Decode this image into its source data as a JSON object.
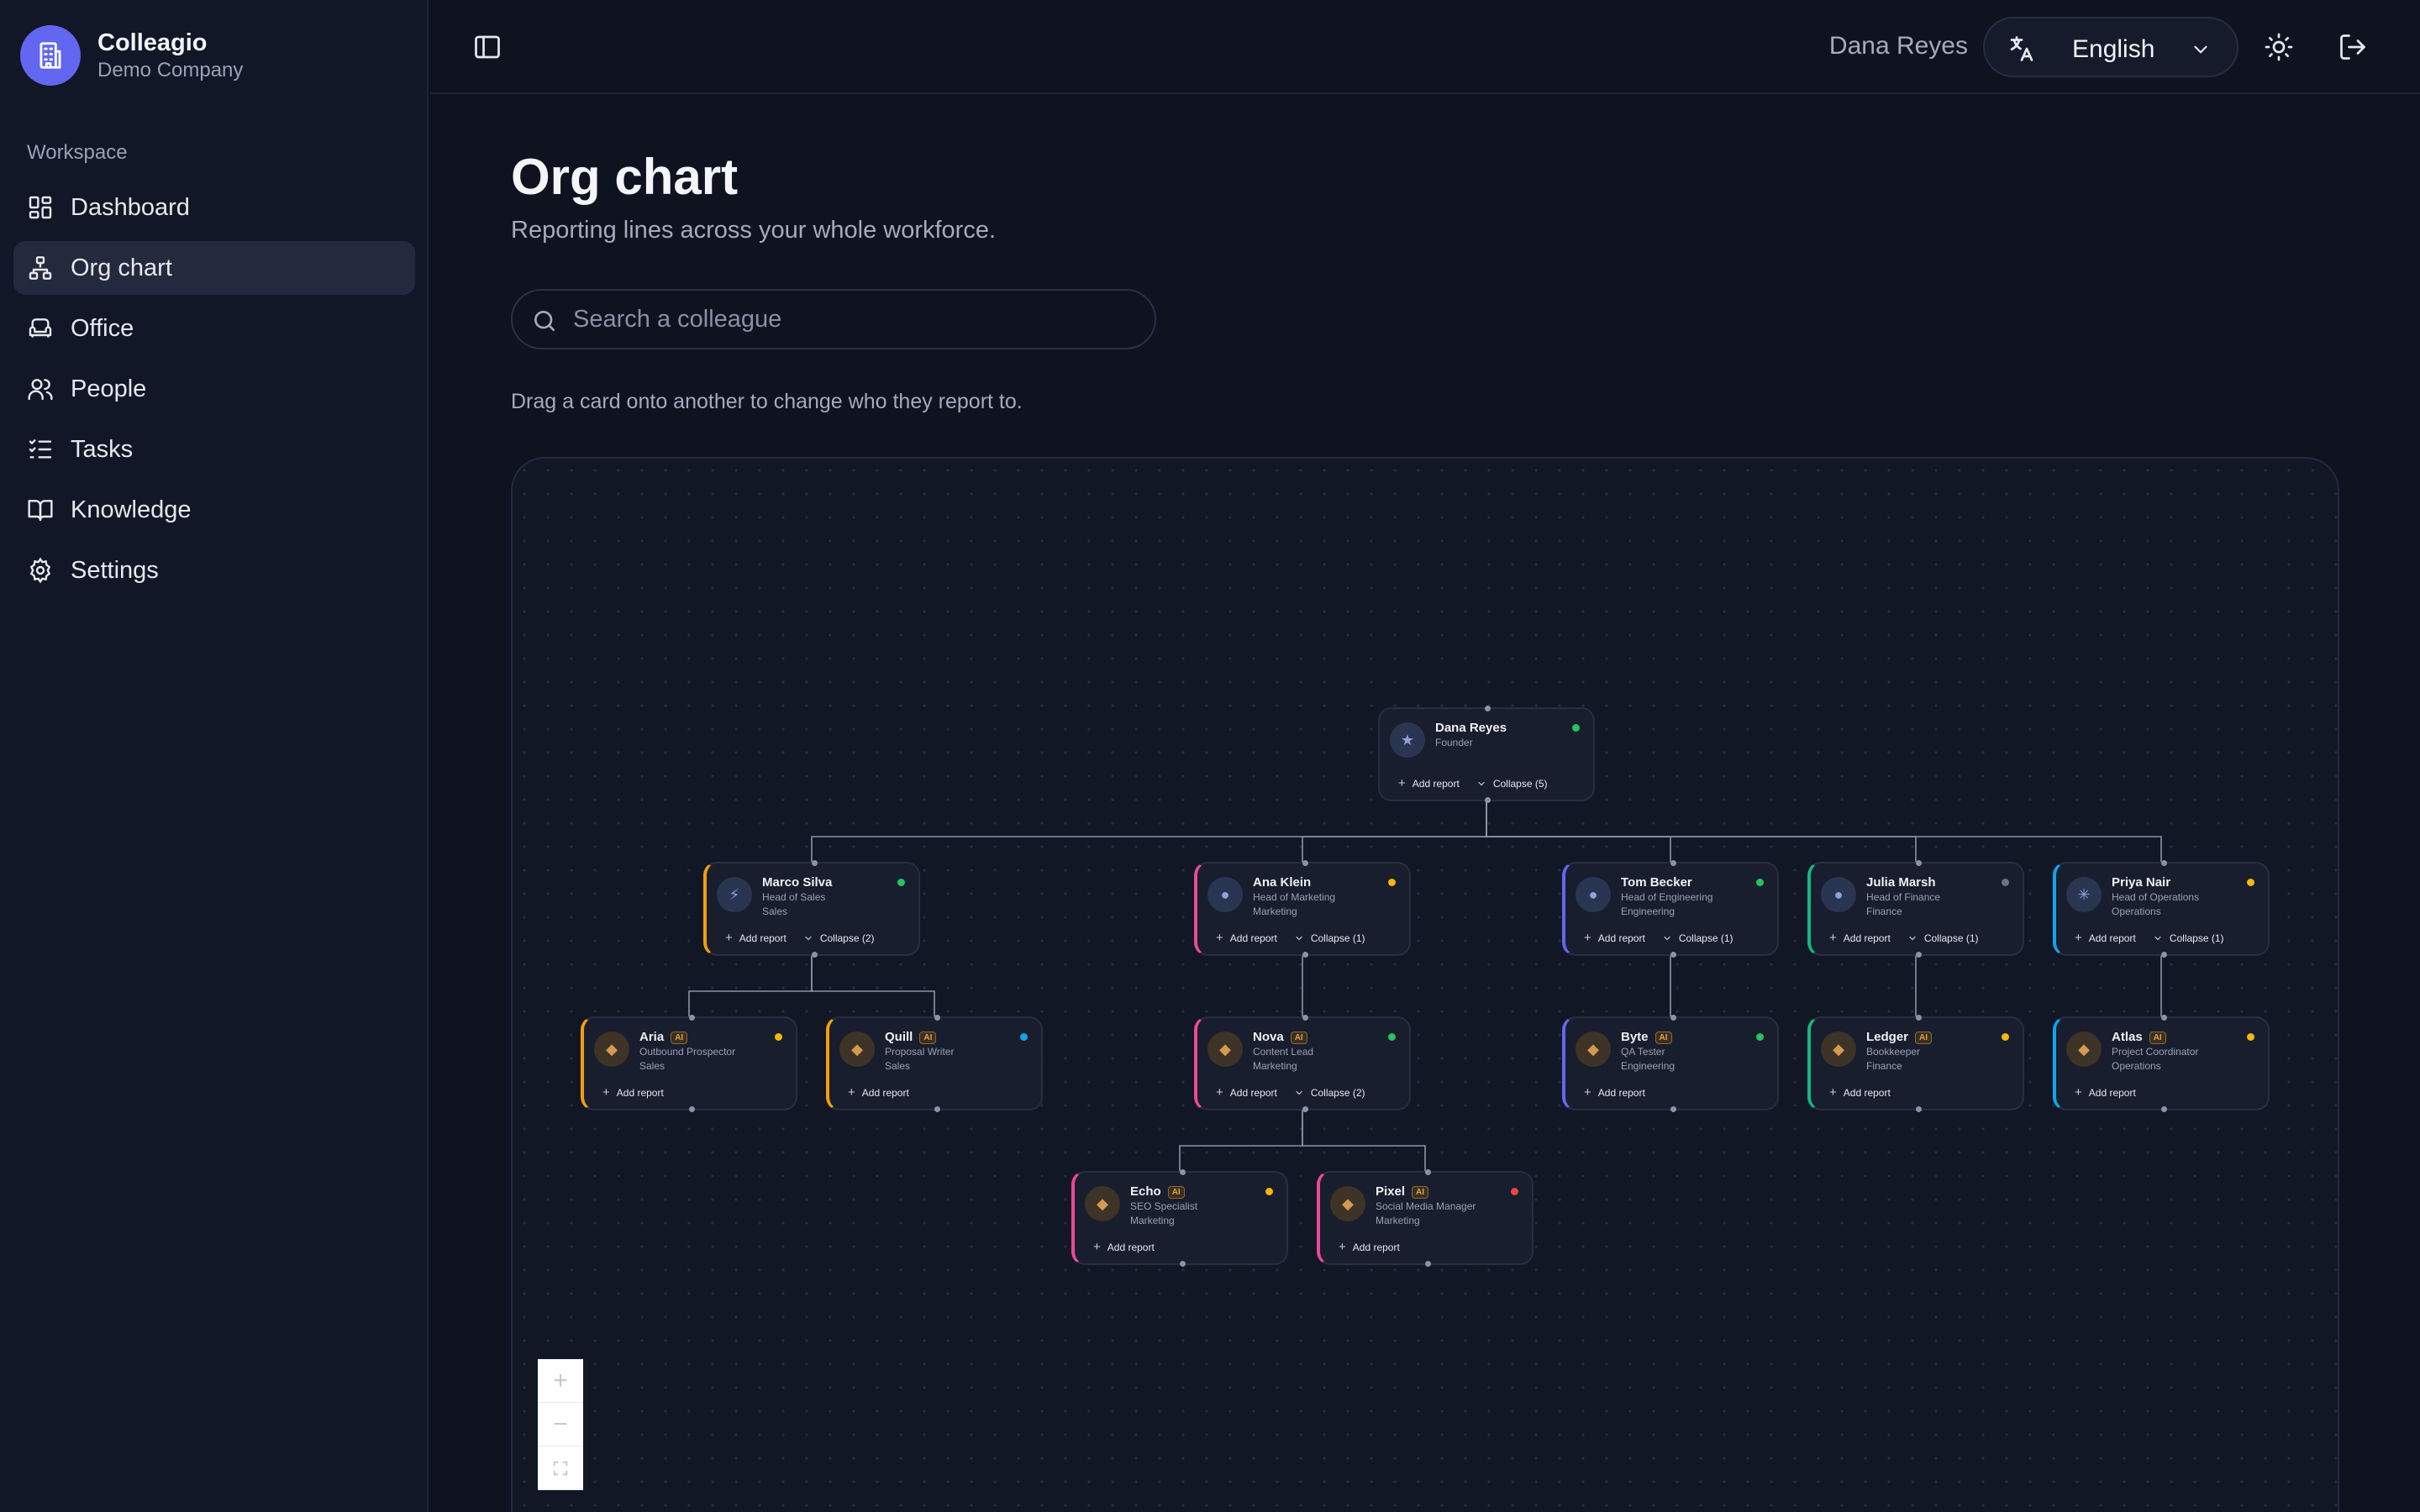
{
  "brand": {
    "name": "Colleagio",
    "company": "Demo Company"
  },
  "sidebar": {
    "section_label": "Workspace",
    "items": [
      {
        "label": "Dashboard",
        "icon": "dashboard-icon"
      },
      {
        "label": "Org chart",
        "icon": "org-chart-icon",
        "active": true
      },
      {
        "label": "Office",
        "icon": "sofa-icon"
      },
      {
        "label": "People",
        "icon": "users-icon"
      },
      {
        "label": "Tasks",
        "icon": "checklist-icon"
      },
      {
        "label": "Knowledge",
        "icon": "book-icon"
      },
      {
        "label": "Settings",
        "icon": "gear-icon"
      }
    ]
  },
  "topbar": {
    "user_name": "Dana Reyes",
    "language": "English"
  },
  "page": {
    "title": "Org chart",
    "subtitle": "Reporting lines across your whole workforce.",
    "search_placeholder": "Search a colleague",
    "hint": "Drag a card onto another to change who they report to."
  },
  "org": {
    "add_report_label": "Add report",
    "ai_badge": "AI",
    "nodes": [
      {
        "id": "dana",
        "name": "Dana Reyes",
        "role": "Founder",
        "dept": "",
        "ai": false,
        "accent": "",
        "status": "#22c55e",
        "icon": "star-icon",
        "collapse": "Collapse (5)"
      },
      {
        "id": "marco",
        "name": "Marco Silva",
        "role": "Head of Sales",
        "dept": "Sales",
        "ai": false,
        "accent": "#f59e0b",
        "status": "#22c55e",
        "icon": "bolt-icon",
        "collapse": "Collapse (2)"
      },
      {
        "id": "ana",
        "name": "Ana Klein",
        "role": "Head of Marketing",
        "dept": "Marketing",
        "ai": false,
        "accent": "#ec4899",
        "status": "#f5b70b",
        "icon": "user-icon",
        "collapse": "Collapse (1)"
      },
      {
        "id": "tom",
        "name": "Tom Becker",
        "role": "Head of Engineering",
        "dept": "Engineering",
        "ai": false,
        "accent": "#6366f1",
        "status": "#22c55e",
        "icon": "user-icon",
        "collapse": "Collapse (1)"
      },
      {
        "id": "julia",
        "name": "Julia Marsh",
        "role": "Head of Finance",
        "dept": "Finance",
        "ai": false,
        "accent": "#10b981",
        "status": "#6b7280",
        "icon": "user-icon",
        "collapse": "Collapse (1)"
      },
      {
        "id": "priya",
        "name": "Priya Nair",
        "role": "Head of Operations",
        "dept": "Operations",
        "ai": false,
        "accent": "#0ea5e9",
        "status": "#f5b70b",
        "icon": "sparkle-icon",
        "collapse": "Collapse (1)"
      },
      {
        "id": "aria",
        "name": "Aria",
        "role": "Outbound Prospector",
        "dept": "Sales",
        "ai": true,
        "accent": "#f59e0b",
        "status": "#f5b70b",
        "icon": "bot-icon",
        "collapse": ""
      },
      {
        "id": "quill",
        "name": "Quill",
        "role": "Proposal Writer",
        "dept": "Sales",
        "ai": true,
        "accent": "#f59e0b",
        "status": "#0ea5e9",
        "icon": "bot-icon",
        "collapse": ""
      },
      {
        "id": "nova",
        "name": "Nova",
        "role": "Content Lead",
        "dept": "Marketing",
        "ai": true,
        "accent": "#ec4899",
        "status": "#22c55e",
        "icon": "bot-icon",
        "collapse": "Collapse (2)"
      },
      {
        "id": "byte",
        "name": "Byte",
        "role": "QA Tester",
        "dept": "Engineering",
        "ai": true,
        "accent": "#6366f1",
        "status": "#22c55e",
        "icon": "bot-icon",
        "collapse": ""
      },
      {
        "id": "ledger",
        "name": "Ledger",
        "role": "Bookkeeper",
        "dept": "Finance",
        "ai": true,
        "accent": "#10b981",
        "status": "#f5b70b",
        "icon": "bot-icon",
        "collapse": ""
      },
      {
        "id": "atlas",
        "name": "Atlas",
        "role": "Project Coordinator",
        "dept": "Operations",
        "ai": true,
        "accent": "#0ea5e9",
        "status": "#f5b70b",
        "icon": "bot-icon",
        "collapse": ""
      },
      {
        "id": "echo",
        "name": "Echo",
        "role": "SEO Specialist",
        "dept": "Marketing",
        "ai": true,
        "accent": "#ec4899",
        "status": "#f5b70b",
        "icon": "bot-icon",
        "collapse": ""
      },
      {
        "id": "pixel",
        "name": "Pixel",
        "role": "Social Media Manager",
        "dept": "Marketing",
        "ai": true,
        "accent": "#ec4899",
        "status": "#ef4444",
        "icon": "bot-icon",
        "collapse": ""
      }
    ],
    "edges": [
      [
        "dana",
        "marco"
      ],
      [
        "dana",
        "ana"
      ],
      [
        "dana",
        "tom"
      ],
      [
        "dana",
        "julia"
      ],
      [
        "dana",
        "priya"
      ],
      [
        "marco",
        "aria"
      ],
      [
        "marco",
        "quill"
      ],
      [
        "ana",
        "nova"
      ],
      [
        "tom",
        "byte"
      ],
      [
        "julia",
        "ledger"
      ],
      [
        "priya",
        "atlas"
      ],
      [
        "nova",
        "echo"
      ],
      [
        "nova",
        "pixel"
      ]
    ]
  }
}
